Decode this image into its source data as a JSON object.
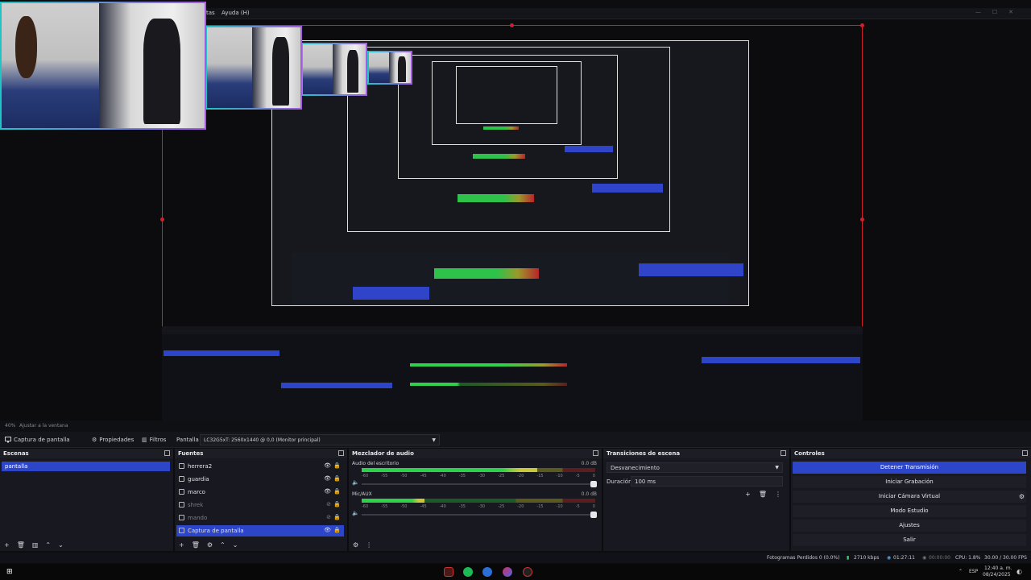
{
  "menubar": {
    "item_herramientas": "tas",
    "item_ayuda": "Ayuda (H)"
  },
  "status_strip": {
    "zoom": "40%",
    "fit": "Ajustar a la ventana"
  },
  "toolbar": {
    "source_name": "Captura de pantalla",
    "properties": "Propiedades",
    "filters": "Filtros",
    "display_label": "Pantalla",
    "display_value": "LC32G5xT: 2560x1440 @ 0,0 (Monitor principal)"
  },
  "scenes": {
    "title": "Escenas",
    "items": [
      "pantalla"
    ]
  },
  "sources": {
    "title": "Fuentes",
    "items": [
      {
        "name": "herrera2",
        "visible": true
      },
      {
        "name": "guardia",
        "visible": true
      },
      {
        "name": "marco",
        "visible": true
      },
      {
        "name": "shrek",
        "visible": false
      },
      {
        "name": "mando",
        "visible": false
      },
      {
        "name": "Captura de pantalla",
        "visible": true
      }
    ]
  },
  "mixer": {
    "title": "Mezclador de audio",
    "channels": [
      {
        "name": "Audio del escritorio",
        "db": "0.0 dB",
        "level": 0.75
      },
      {
        "name": "Mic/AUX",
        "db": "0.0 dB",
        "level": 0.27
      }
    ],
    "ticks": [
      "-60",
      "-55",
      "-50",
      "-45",
      "-40",
      "-35",
      "-30",
      "-25",
      "-20",
      "-15",
      "-10",
      "-5",
      "0"
    ]
  },
  "transitions": {
    "title": "Transiciones de escena",
    "selected": "Desvanecimiento",
    "duration_label": "Duración",
    "duration_value": "100 ms"
  },
  "controls": {
    "title": "Controles",
    "buttons": [
      "Detener Transmisión",
      "Iniciar Grabación",
      "Iniciar Cámara Virtual",
      "Modo Estudio",
      "Ajustes",
      "Salir"
    ]
  },
  "statusbar": {
    "dropped": "Fotogramas Perdidos 0 (0.0%)",
    "bitrate": "2710 kbps",
    "stream_time": "01:27:11",
    "rec_time": "00:00:00",
    "cpu": "CPU: 1.8%",
    "fps": "30.00 / 30.00 FPS"
  },
  "taskbar": {
    "lang": "ESP",
    "time": "12:40 a. m.",
    "date": "08/24/2025"
  },
  "colors": {
    "accent": "#2d46c9",
    "frame": "#d0202a",
    "green": "#2fd04a"
  }
}
